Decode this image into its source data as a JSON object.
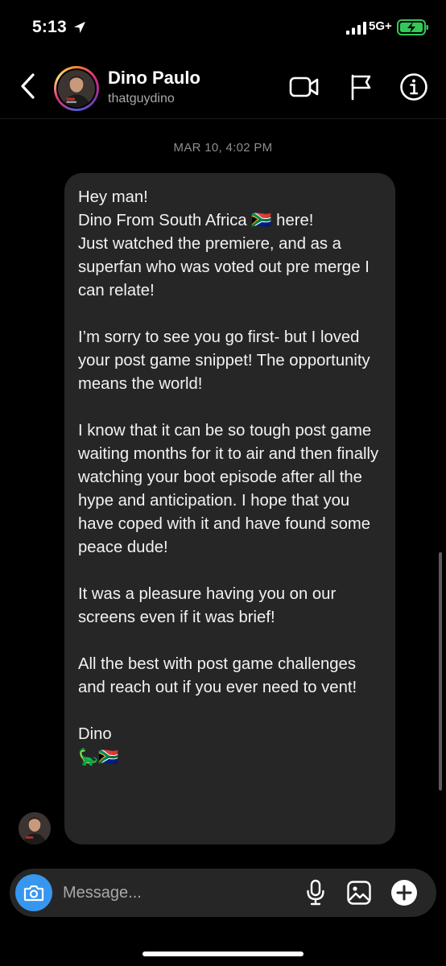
{
  "status_bar": {
    "time": "5:13",
    "network": "5G+"
  },
  "header": {
    "contact_name": "Dino Paulo",
    "contact_handle": "thatguydino",
    "back_icon": "chevron-left-icon",
    "video_icon": "video-camera-icon",
    "flag_icon": "flag-icon",
    "info_icon": "info-icon"
  },
  "conversation": {
    "timestamp": "MAR 10, 4:02 PM",
    "message": {
      "text": "Hey man!\nDino From South Africa 🇿🇦  here!\nJust watched the premiere, and as a superfan who was voted out pre merge I can relate!\n\nI’m sorry to see you go first- but I loved your post game snippet! The opportunity means the world!\n\nI know that it can be so tough post game waiting months for it to air and then finally watching your boot episode after all the hype and anticipation. I hope that you have coped with it and have found some peace dude!\n\nIt was a pleasure having you on our screens even if it was brief!\n\nAll the best with post game challenges and reach out if you ever need to vent!\n\nDino\n🦕🇿🇦"
    }
  },
  "composer": {
    "placeholder": "Message...",
    "camera_icon": "camera-icon",
    "mic_icon": "microphone-icon",
    "gallery_icon": "image-gallery-icon",
    "plus_icon": "plus-circle-icon"
  },
  "colors": {
    "background": "#000000",
    "bubble": "#262626",
    "accent": "#3797f0",
    "secondary_text": "#a8a8a8",
    "battery_green": "#34c759"
  }
}
